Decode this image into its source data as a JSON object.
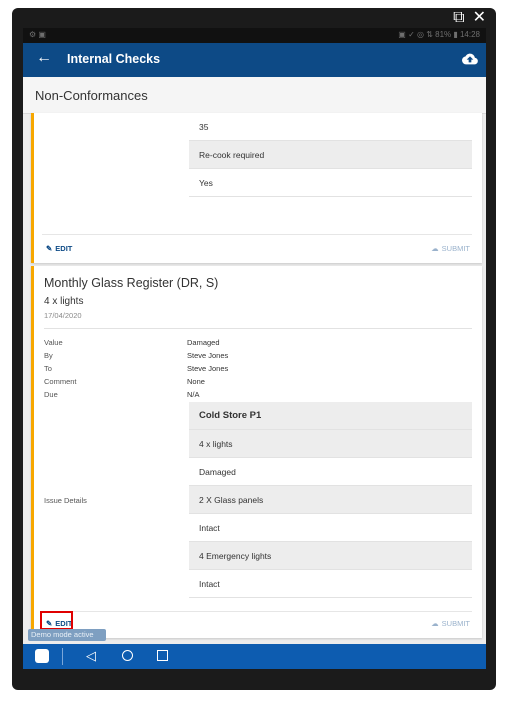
{
  "statusbar": {
    "left": "⚙ ▣",
    "right": "▣ ✓ ◎ ⇅ 81% ▮ 14:28"
  },
  "appbar": {
    "back_icon": "arrow-left-icon",
    "title": "Internal Checks",
    "upload_icon": "cloud-upload-icon"
  },
  "section": {
    "title": "Non-Conformances"
  },
  "card1": {
    "rows": [
      "35",
      "Re-cook required",
      "Yes"
    ],
    "edit_label": "EDIT",
    "submit_label": "SUBMIT"
  },
  "card2": {
    "title": "Monthly Glass Register (DR, S)",
    "subtitle": "4 x lights",
    "date": "17/04/2020",
    "fields": {
      "value_label": "Value",
      "value": "Damaged",
      "by_label": "By",
      "by": "Steve Jones",
      "to_label": "To",
      "to": "Steve Jones",
      "comment_label": "Comment",
      "comment": "None",
      "due_label": "Due",
      "due": "N/A",
      "issue_label": "Issue Details"
    },
    "issue_rows": [
      "Cold Store P1",
      "4 x lights",
      "Damaged",
      "2 X Glass panels",
      "Intact",
      "4 Emergency lights",
      "Intact"
    ],
    "edit_label": "EDIT",
    "submit_label": "SUBMIT"
  },
  "toast": {
    "text": "Demo mode active"
  },
  "colors": {
    "appbar": "#0d4a86",
    "accent": "#f7a700",
    "highlight": "#e00000",
    "navbar": "#0d5cb0"
  }
}
